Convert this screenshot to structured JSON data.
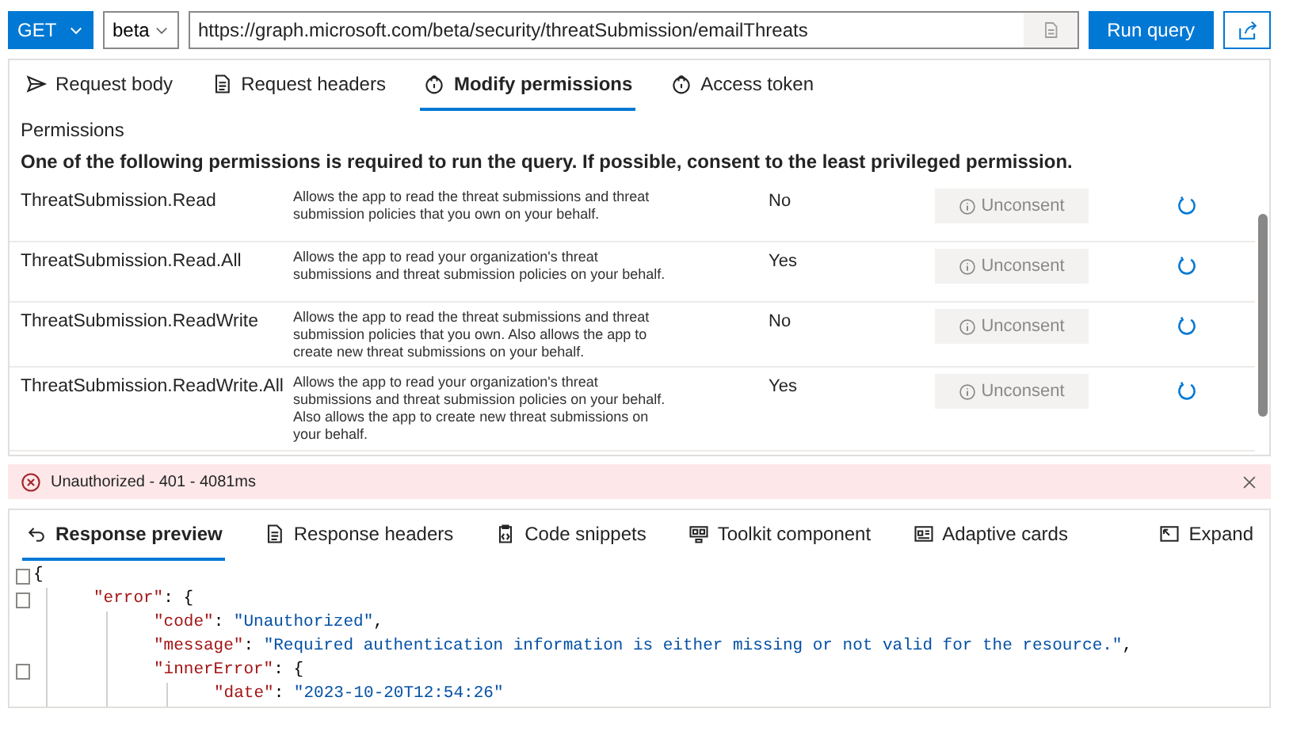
{
  "query_bar": {
    "method": "GET",
    "version": "beta",
    "url": "https://graph.microsoft.com/beta/security/threatSubmission/emailThreats",
    "run_button": "Run query"
  },
  "request_tabs": [
    {
      "label": "Request body",
      "selected": false
    },
    {
      "label": "Request headers",
      "selected": false
    },
    {
      "label": "Modify permissions",
      "selected": true
    },
    {
      "label": "Access token",
      "selected": false
    }
  ],
  "permissions": {
    "title": "Permissions",
    "note": "One of the following permissions is required to run the query. If possible, consent to the least privileged permission.",
    "rows": [
      {
        "name": "ThreatSubmission.Read",
        "description": "Allows the app to read the threat submissions and threat submission policies that you own on your behalf.",
        "admin_consent": "No",
        "button": "Unconsent",
        "disabled": true
      },
      {
        "name": "ThreatSubmission.Read.All",
        "description": "Allows the app to read your organization's threat submissions and threat submission policies on your behalf.",
        "admin_consent": "Yes",
        "button": "Unconsent",
        "disabled": true
      },
      {
        "name": "ThreatSubmission.ReadWrite",
        "description": "Allows the app to read the threat submissions and threat submission policies that you own. Also allows the app to create new threat submissions on your behalf.",
        "admin_consent": "No",
        "button": "Unconsent",
        "disabled": true
      },
      {
        "name": "ThreatSubmission.ReadWrite.All",
        "description": "Allows the app to read your organization's threat submissions and threat submission policies on your behalf. Also allows the app to create new threat submissions on your behalf.",
        "admin_consent": "Yes",
        "button": "Unconsent",
        "disabled": true
      }
    ]
  },
  "status_bar": {
    "text": "Unauthorized - 401 - 4081ms"
  },
  "response_tabs": [
    {
      "label": "Response preview",
      "selected": true
    },
    {
      "label": "Response headers",
      "selected": false
    },
    {
      "label": "Code snippets",
      "selected": false
    },
    {
      "label": "Toolkit component",
      "selected": false
    },
    {
      "label": "Adaptive cards",
      "selected": false
    }
  ],
  "expand": "Expand",
  "code": [
    {
      "foldable": true,
      "tokens": [
        {
          "kind": "punct",
          "text": "{"
        }
      ],
      "children": [
        {
          "foldable": true,
          "tokens": [
            {
              "kind": "key",
              "text": "\"error\""
            },
            {
              "kind": "punct",
              "text": ": {"
            }
          ],
          "children": [
            {
              "foldable": false,
              "tokens": [
                {
                  "kind": "key",
                  "text": "\"code\""
                },
                {
                  "kind": "punct",
                  "text": ": "
                },
                {
                  "kind": "string",
                  "text": "\"Unauthorized\""
                },
                {
                  "kind": "punct",
                  "text": ","
                }
              ]
            },
            {
              "foldable": false,
              "tokens": [
                {
                  "kind": "key",
                  "text": "\"message\""
                },
                {
                  "kind": "punct",
                  "text": ": "
                },
                {
                  "kind": "string",
                  "text": "\"Required authentication information is either missing or not valid for the resource.\""
                },
                {
                  "kind": "punct",
                  "text": ","
                }
              ]
            },
            {
              "foldable": true,
              "tokens": [
                {
                  "kind": "key",
                  "text": "\"innerError\""
                },
                {
                  "kind": "punct",
                  "text": ": {"
                }
              ],
              "children": [
                {
                  "foldable": false,
                  "tokens": [
                    {
                      "kind": "key",
                      "text": "\"date\""
                    },
                    {
                      "kind": "punct",
                      "text": ": "
                    },
                    {
                      "kind": "string",
                      "text": "\"2023-10-20T12:54:26\""
                    }
                  ]
                }
              ]
            }
          ]
        }
      ]
    }
  ]
}
